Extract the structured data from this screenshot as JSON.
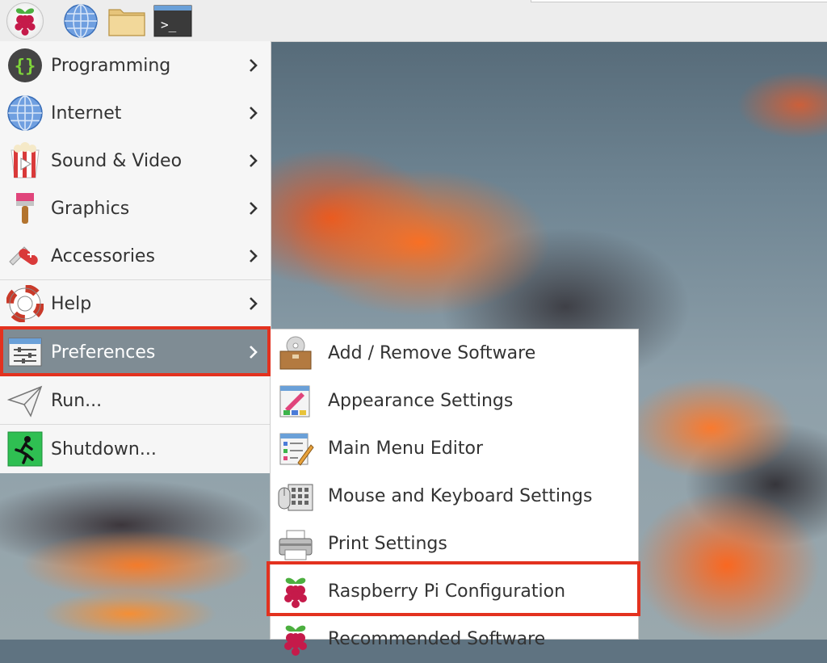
{
  "taskbar": {
    "menu_icon": "raspberry-pi-icon",
    "browser_icon": "globe-icon",
    "files_icon": "folder-icon",
    "terminal_icon": "terminal-icon",
    "terminal_glyph": ">_"
  },
  "main_menu": {
    "items": [
      {
        "label": "Programming",
        "icon": "programming-icon"
      },
      {
        "label": "Internet",
        "icon": "globe-icon"
      },
      {
        "label": "Sound & Video",
        "icon": "popcorn-icon"
      },
      {
        "label": "Graphics",
        "icon": "paintbrush-icon"
      },
      {
        "label": "Accessories",
        "icon": "swiss-knife-icon"
      },
      {
        "label": "Help",
        "icon": "lifebuoy-icon"
      },
      {
        "label": "Preferences",
        "icon": "preferences-icon",
        "selected": true
      },
      {
        "label": "Run...",
        "icon": "paper-plane-icon"
      },
      {
        "label": "Shutdown...",
        "icon": "exit-icon"
      }
    ]
  },
  "preferences_menu": {
    "items": [
      {
        "label": "Add / Remove Software",
        "icon": "package-icon"
      },
      {
        "label": "Appearance Settings",
        "icon": "appearance-icon"
      },
      {
        "label": "Main Menu Editor",
        "icon": "menu-editor-icon"
      },
      {
        "label": "Mouse and Keyboard Settings",
        "icon": "mouse-keyboard-icon"
      },
      {
        "label": "Print Settings",
        "icon": "printer-icon"
      },
      {
        "label": "Raspberry Pi Configuration",
        "icon": "raspberry-pi-icon",
        "highlighted": true
      },
      {
        "label": "Recommended Software",
        "icon": "raspberry-pi-icon"
      }
    ]
  },
  "colors": {
    "highlight_border": "#e3321f",
    "selected_row": "#7f8c94"
  }
}
